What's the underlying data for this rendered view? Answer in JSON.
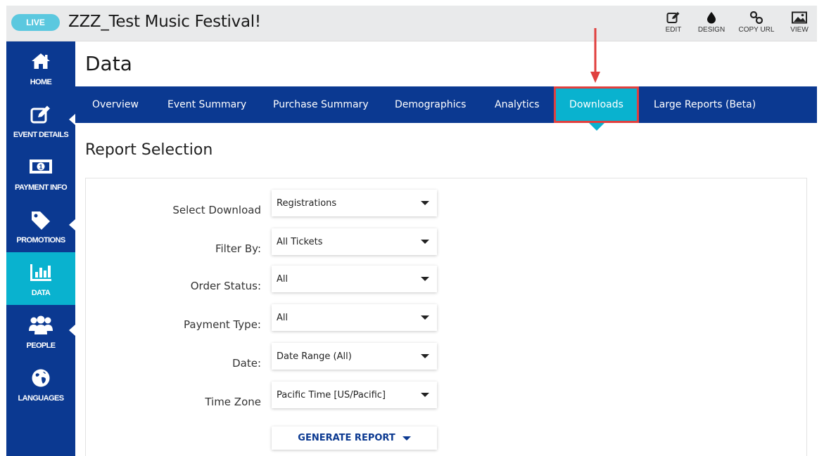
{
  "header": {
    "live_badge": "LIVE",
    "event_title": "ZZZ_Test Music Festival!",
    "actions": [
      {
        "icon": "edit-icon",
        "label": "EDIT"
      },
      {
        "icon": "design-icon",
        "label": "DESIGN"
      },
      {
        "icon": "link-icon",
        "label": "COPY URL"
      },
      {
        "icon": "image-icon",
        "label": "VIEW"
      }
    ]
  },
  "sidebar": {
    "items": [
      {
        "icon": "home-icon",
        "label": "HOME"
      },
      {
        "icon": "edit-icon",
        "label": "EVENT DETAILS"
      },
      {
        "icon": "money-icon",
        "label": "PAYMENT INFO"
      },
      {
        "icon": "tag-icon",
        "label": "PROMOTIONS"
      },
      {
        "icon": "bar-chart-icon",
        "label": "DATA",
        "active": true
      },
      {
        "icon": "people-icon",
        "label": "PEOPLE"
      },
      {
        "icon": "globe-icon",
        "label": "LANGUAGES"
      }
    ]
  },
  "page": {
    "title": "Data",
    "tabs": [
      {
        "label": "Overview"
      },
      {
        "label": "Event Summary"
      },
      {
        "label": "Purchase Summary"
      },
      {
        "label": "Demographics"
      },
      {
        "label": "Analytics"
      },
      {
        "label": "Downloads",
        "active": true
      },
      {
        "label": "Large Reports (Beta)"
      }
    ],
    "section_title": "Report Selection"
  },
  "form": {
    "fields": [
      {
        "label": "Select Download",
        "value": "Registrations"
      },
      {
        "label": "Filter By:",
        "value": "All Tickets"
      },
      {
        "label": "Order Status:",
        "value": "All"
      },
      {
        "label": "Payment Type:",
        "value": "All"
      },
      {
        "label": "Date:",
        "value": "Date Range (All)"
      },
      {
        "label": "Time Zone",
        "value": "Pacific Time [US/Pacific]"
      }
    ],
    "generate_label": "GENERATE REPORT"
  },
  "colors": {
    "navy": "#0b3991",
    "cyan": "#09b2cf",
    "highlight": "#e0403f",
    "live": "#5bc8df"
  }
}
